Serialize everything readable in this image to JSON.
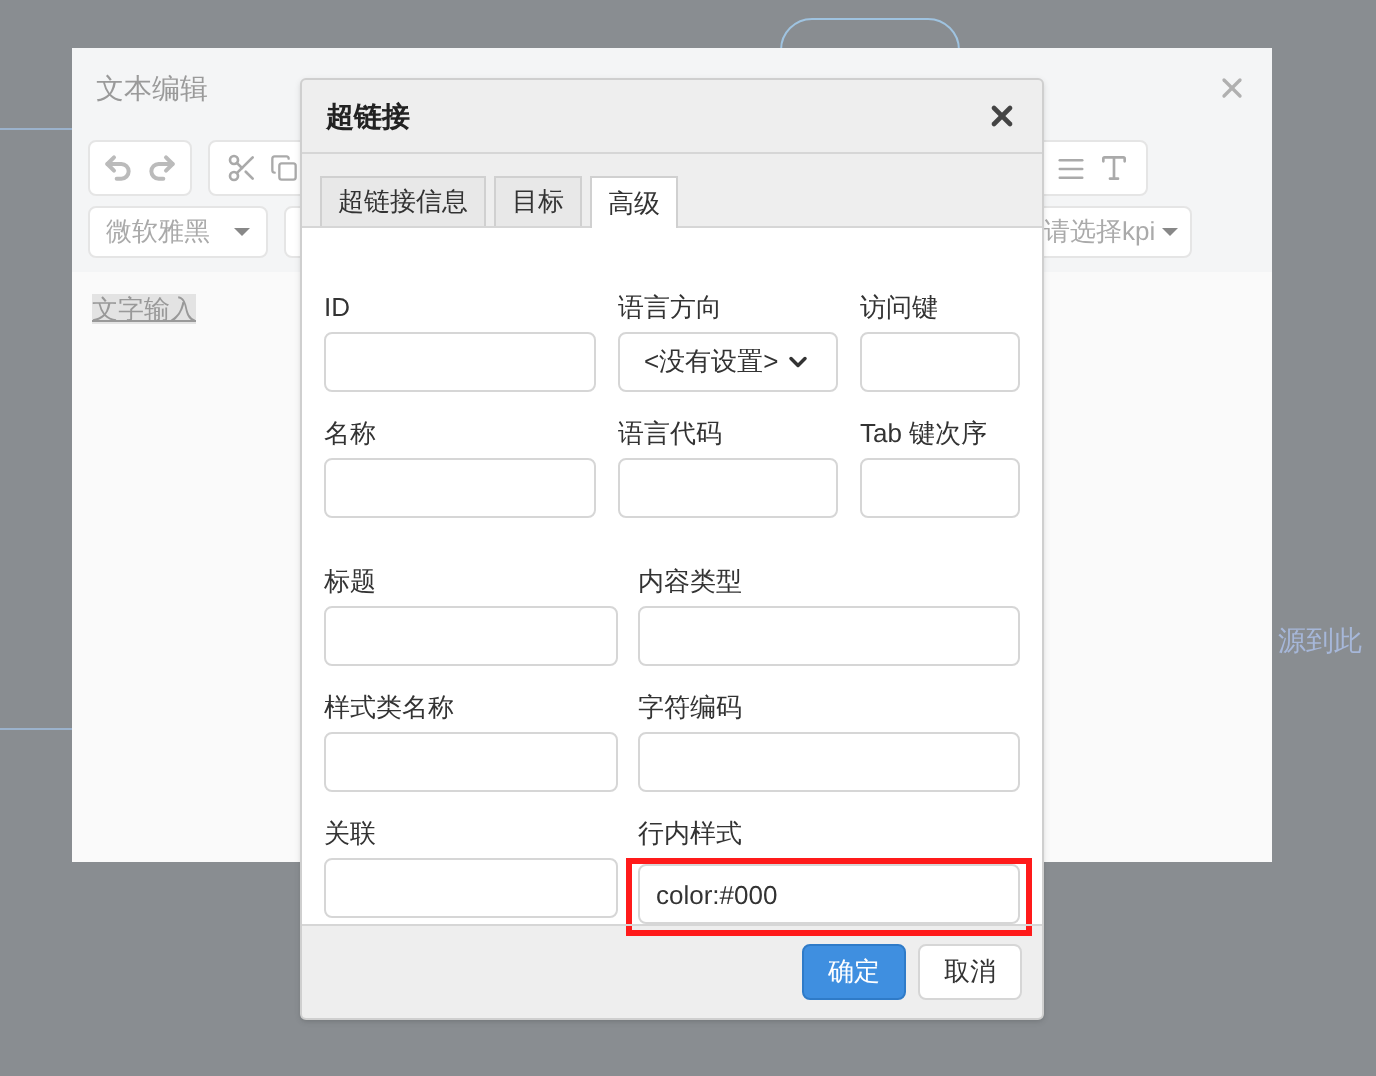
{
  "background_hint": "源到此",
  "editor": {
    "title": "文本编辑",
    "font_select": "微软雅黑",
    "kpi_select": "请选择kpi",
    "content": "文字输入"
  },
  "dialog": {
    "title": "超链接",
    "tabs": [
      {
        "label": "超链接信息",
        "selected": false
      },
      {
        "label": "目标",
        "selected": false
      },
      {
        "label": "高级",
        "selected": true
      }
    ],
    "fields_top": [
      {
        "label": "ID",
        "kind": "input"
      },
      {
        "label": "语言方向",
        "kind": "select",
        "value": "<没有设置>"
      },
      {
        "label": "访问键",
        "kind": "input"
      },
      {
        "label": "名称",
        "kind": "input"
      },
      {
        "label": "语言代码",
        "kind": "input"
      },
      {
        "label": "Tab 键次序",
        "kind": "input"
      }
    ],
    "fields_bottom": [
      {
        "label": "标题",
        "kind": "input"
      },
      {
        "label": "内容类型",
        "kind": "input"
      },
      {
        "label": "样式类名称",
        "kind": "input"
      },
      {
        "label": "字符编码",
        "kind": "input"
      },
      {
        "label": "关联",
        "kind": "input"
      },
      {
        "label": "行内样式",
        "kind": "input",
        "value": "color:#000",
        "highlighted": true
      }
    ],
    "buttons": [
      {
        "label": "确定",
        "kind": "primary"
      },
      {
        "label": "取消",
        "kind": "default"
      }
    ]
  }
}
